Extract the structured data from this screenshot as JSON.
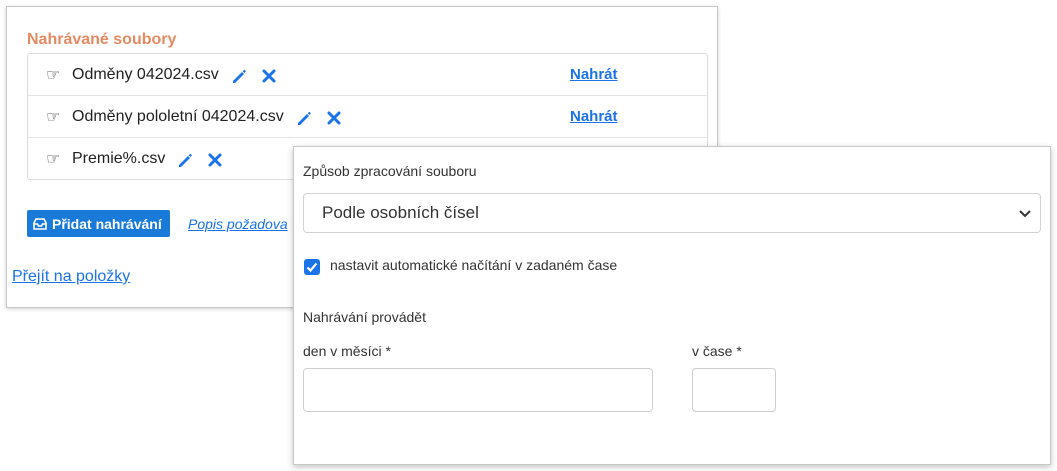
{
  "upload_section": {
    "title": "Nahrávané soubory",
    "files": [
      {
        "name": "Odměny 042024.csv",
        "upload_label": "Nahrát"
      },
      {
        "name": "Odměny pololetní 042024.csv",
        "upload_label": "Nahrát"
      },
      {
        "name": "Premie%.csv",
        "upload_label": ""
      }
    ],
    "add_button_label": "Přidat nahrávání",
    "description_link": "Popis požadova",
    "goto_link": "Přejít na položky"
  },
  "processing": {
    "method_label": "Způsob zpracování souboru",
    "method_value": "Podle osobních čísel",
    "auto_load_checked": true,
    "auto_load_label": "nastavit automatické načítání v zadaném čase",
    "schedule_heading": "Nahrávání provádět",
    "day_label": "den v měsíci *",
    "time_label": "v čase *",
    "day_value": "",
    "time_value": ""
  },
  "colors": {
    "section_title": "#e58a63",
    "primary": "#1a7ad9",
    "link": "#1a73e8",
    "icon_blue": "#1a73e8"
  },
  "icons": {
    "row_icon": "pointing-hand-icon",
    "edit": "pencil-icon",
    "delete": "close-icon",
    "add": "inbox-icon",
    "select": "chevron-down-icon",
    "checkbox": "checkmark-icon"
  }
}
